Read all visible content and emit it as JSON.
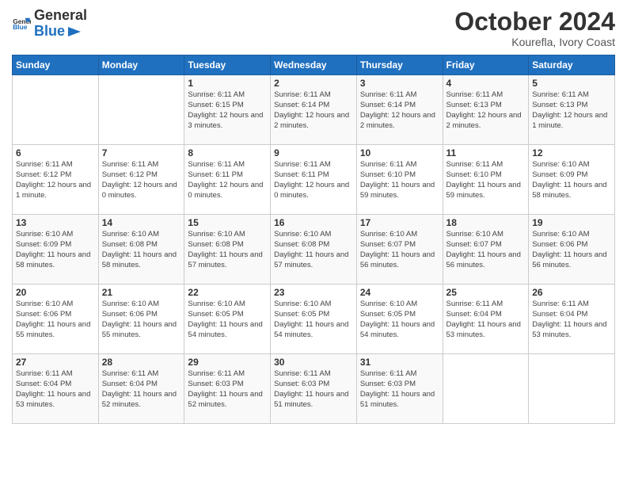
{
  "header": {
    "logo_general": "General",
    "logo_blue": "Blue",
    "month_title": "October 2024",
    "subtitle": "Kourefla, Ivory Coast"
  },
  "days_of_week": [
    "Sunday",
    "Monday",
    "Tuesday",
    "Wednesday",
    "Thursday",
    "Friday",
    "Saturday"
  ],
  "weeks": [
    [
      {
        "day": "",
        "detail": ""
      },
      {
        "day": "",
        "detail": ""
      },
      {
        "day": "1",
        "detail": "Sunrise: 6:11 AM\nSunset: 6:15 PM\nDaylight: 12 hours and 3 minutes."
      },
      {
        "day": "2",
        "detail": "Sunrise: 6:11 AM\nSunset: 6:14 PM\nDaylight: 12 hours and 2 minutes."
      },
      {
        "day": "3",
        "detail": "Sunrise: 6:11 AM\nSunset: 6:14 PM\nDaylight: 12 hours and 2 minutes."
      },
      {
        "day": "4",
        "detail": "Sunrise: 6:11 AM\nSunset: 6:13 PM\nDaylight: 12 hours and 2 minutes."
      },
      {
        "day": "5",
        "detail": "Sunrise: 6:11 AM\nSunset: 6:13 PM\nDaylight: 12 hours and 1 minute."
      }
    ],
    [
      {
        "day": "6",
        "detail": "Sunrise: 6:11 AM\nSunset: 6:12 PM\nDaylight: 12 hours and 1 minute."
      },
      {
        "day": "7",
        "detail": "Sunrise: 6:11 AM\nSunset: 6:12 PM\nDaylight: 12 hours and 0 minutes."
      },
      {
        "day": "8",
        "detail": "Sunrise: 6:11 AM\nSunset: 6:11 PM\nDaylight: 12 hours and 0 minutes."
      },
      {
        "day": "9",
        "detail": "Sunrise: 6:11 AM\nSunset: 6:11 PM\nDaylight: 12 hours and 0 minutes."
      },
      {
        "day": "10",
        "detail": "Sunrise: 6:11 AM\nSunset: 6:10 PM\nDaylight: 11 hours and 59 minutes."
      },
      {
        "day": "11",
        "detail": "Sunrise: 6:11 AM\nSunset: 6:10 PM\nDaylight: 11 hours and 59 minutes."
      },
      {
        "day": "12",
        "detail": "Sunrise: 6:10 AM\nSunset: 6:09 PM\nDaylight: 11 hours and 58 minutes."
      }
    ],
    [
      {
        "day": "13",
        "detail": "Sunrise: 6:10 AM\nSunset: 6:09 PM\nDaylight: 11 hours and 58 minutes."
      },
      {
        "day": "14",
        "detail": "Sunrise: 6:10 AM\nSunset: 6:08 PM\nDaylight: 11 hours and 58 minutes."
      },
      {
        "day": "15",
        "detail": "Sunrise: 6:10 AM\nSunset: 6:08 PM\nDaylight: 11 hours and 57 minutes."
      },
      {
        "day": "16",
        "detail": "Sunrise: 6:10 AM\nSunset: 6:08 PM\nDaylight: 11 hours and 57 minutes."
      },
      {
        "day": "17",
        "detail": "Sunrise: 6:10 AM\nSunset: 6:07 PM\nDaylight: 11 hours and 56 minutes."
      },
      {
        "day": "18",
        "detail": "Sunrise: 6:10 AM\nSunset: 6:07 PM\nDaylight: 11 hours and 56 minutes."
      },
      {
        "day": "19",
        "detail": "Sunrise: 6:10 AM\nSunset: 6:06 PM\nDaylight: 11 hours and 56 minutes."
      }
    ],
    [
      {
        "day": "20",
        "detail": "Sunrise: 6:10 AM\nSunset: 6:06 PM\nDaylight: 11 hours and 55 minutes."
      },
      {
        "day": "21",
        "detail": "Sunrise: 6:10 AM\nSunset: 6:06 PM\nDaylight: 11 hours and 55 minutes."
      },
      {
        "day": "22",
        "detail": "Sunrise: 6:10 AM\nSunset: 6:05 PM\nDaylight: 11 hours and 54 minutes."
      },
      {
        "day": "23",
        "detail": "Sunrise: 6:10 AM\nSunset: 6:05 PM\nDaylight: 11 hours and 54 minutes."
      },
      {
        "day": "24",
        "detail": "Sunrise: 6:10 AM\nSunset: 6:05 PM\nDaylight: 11 hours and 54 minutes."
      },
      {
        "day": "25",
        "detail": "Sunrise: 6:11 AM\nSunset: 6:04 PM\nDaylight: 11 hours and 53 minutes."
      },
      {
        "day": "26",
        "detail": "Sunrise: 6:11 AM\nSunset: 6:04 PM\nDaylight: 11 hours and 53 minutes."
      }
    ],
    [
      {
        "day": "27",
        "detail": "Sunrise: 6:11 AM\nSunset: 6:04 PM\nDaylight: 11 hours and 53 minutes."
      },
      {
        "day": "28",
        "detail": "Sunrise: 6:11 AM\nSunset: 6:04 PM\nDaylight: 11 hours and 52 minutes."
      },
      {
        "day": "29",
        "detail": "Sunrise: 6:11 AM\nSunset: 6:03 PM\nDaylight: 11 hours and 52 minutes."
      },
      {
        "day": "30",
        "detail": "Sunrise: 6:11 AM\nSunset: 6:03 PM\nDaylight: 11 hours and 51 minutes."
      },
      {
        "day": "31",
        "detail": "Sunrise: 6:11 AM\nSunset: 6:03 PM\nDaylight: 11 hours and 51 minutes."
      },
      {
        "day": "",
        "detail": ""
      },
      {
        "day": "",
        "detail": ""
      }
    ]
  ]
}
